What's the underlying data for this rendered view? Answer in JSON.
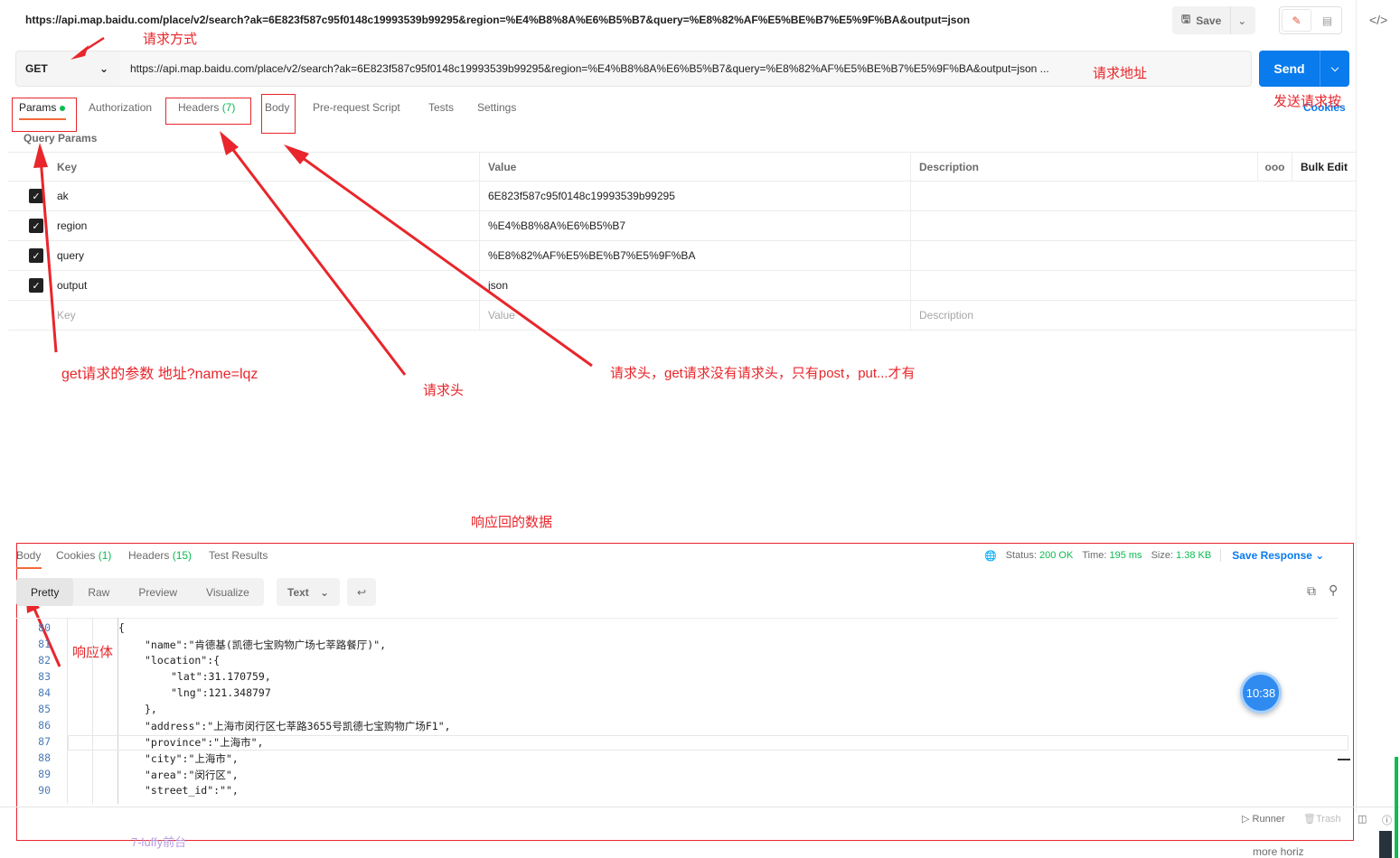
{
  "top": {
    "url": "https://api.map.baidu.com/place/v2/search?ak=6E823f587c95f0148c19993539b99295&region=%E4%B8%8A%E6%B5%B7&query=%E8%82%AF%E5%BE%B7%E5%9F%BA&output=json",
    "save_label": "Save"
  },
  "request": {
    "method": "GET",
    "url": "https://api.map.baidu.com/place/v2/search?ak=6E823f587c95f0148c19993539b99295&region=%E4%B8%8A%E6%B5%B7&query=%E8%82%AF%E5%BE%B7%E5%9F%BA&output=json ...",
    "send_label": "Send"
  },
  "tabs": {
    "params": "Params",
    "authorization": "Authorization",
    "headers": "Headers",
    "headers_count": "(7)",
    "body": "Body",
    "prerequest": "Pre-request Script",
    "tests": "Tests",
    "settings": "Settings",
    "cookies": "Cookies"
  },
  "query_params": {
    "title": "Query Params",
    "headers": {
      "key": "Key",
      "value": "Value",
      "description": "Description",
      "bulk_edit": "Bulk Edit",
      "more": "ooo"
    },
    "rows": [
      {
        "key": "ak",
        "value": "6E823f587c95f0148c19993539b99295"
      },
      {
        "key": "region",
        "value": "%E4%B8%8A%E6%B5%B7"
      },
      {
        "key": "query",
        "value": "%E8%82%AF%E5%BE%B7%E5%9F%BA"
      },
      {
        "key": "output",
        "value": "json"
      }
    ],
    "placeholder": {
      "key": "Key",
      "value": "Value",
      "description": "Description"
    }
  },
  "annotations": {
    "method": "请求方式",
    "url": "请求地址",
    "send": "发送请求按",
    "params": "get请求的参数   地址?name=lqz",
    "headers": "请求头",
    "body": "请求头，get请求没有请求头，只有post，put...才有",
    "response": "响应回的数据",
    "response_body": "响应体"
  },
  "response": {
    "tabs": {
      "body": "Body",
      "cookies": "Cookies",
      "cookies_count": "(1)",
      "headers": "Headers",
      "headers_count": "(15)",
      "test_results": "Test Results"
    },
    "status_label": "Status:",
    "status_value": "200 OK",
    "time_label": "Time:",
    "time_value": "195 ms",
    "size_label": "Size:",
    "size_value": "1.38 KB",
    "save_response": "Save Response",
    "views": {
      "pretty": "Pretty",
      "raw": "Raw",
      "preview": "Preview",
      "visualize": "Visualize"
    },
    "format": "Text",
    "code_lines": [
      {
        "n": "80",
        "text": "{"
      },
      {
        "n": "81",
        "text": "\"name\":\"肯德基(凯德七宝购物广场七莘路餐厅)\","
      },
      {
        "n": "82",
        "text": "\"location\":{"
      },
      {
        "n": "83",
        "text": "\"lat\":31.170759,"
      },
      {
        "n": "84",
        "text": "\"lng\":121.348797"
      },
      {
        "n": "85",
        "text": "},"
      },
      {
        "n": "86",
        "text": "\"address\":\"上海市闵行区七莘路3655号凯德七宝购物广场F1\","
      },
      {
        "n": "87",
        "text": "\"province\":\"上海市\","
      },
      {
        "n": "88",
        "text": "\"city\":\"上海市\","
      },
      {
        "n": "89",
        "text": "\"area\":\"闵行区\","
      },
      {
        "n": "90",
        "text": "\"street_id\":\"\","
      }
    ]
  },
  "timer": "10:38",
  "footer": {
    "runner": "Runner",
    "trash": "Trash",
    "link": "7-luffy前台",
    "right_text": "more  horiz"
  },
  "colors": {
    "accent": "#097bed",
    "annotation": "#e8262b",
    "status_ok": "#0cbb52",
    "tab_underline": "#f26b3a"
  }
}
